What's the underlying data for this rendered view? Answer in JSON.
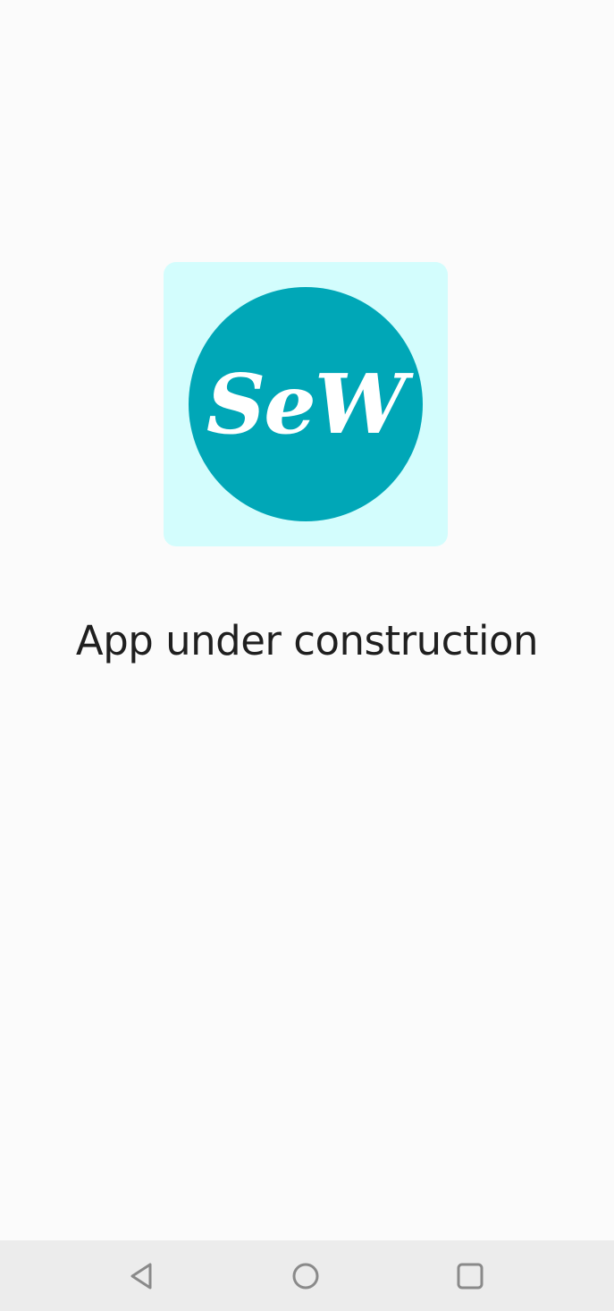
{
  "logo": {
    "text": "SeW",
    "tile_color": "#d3fdfd",
    "circle_color": "#00a7b7",
    "text_color": "#ffffff"
  },
  "message": "App under construction",
  "nav_bar": {
    "background": "#ececec",
    "icon_color": "#8a8a8a",
    "buttons": [
      {
        "icon": "back-triangle-icon"
      },
      {
        "icon": "home-circle-icon"
      },
      {
        "icon": "recents-square-icon"
      }
    ]
  }
}
